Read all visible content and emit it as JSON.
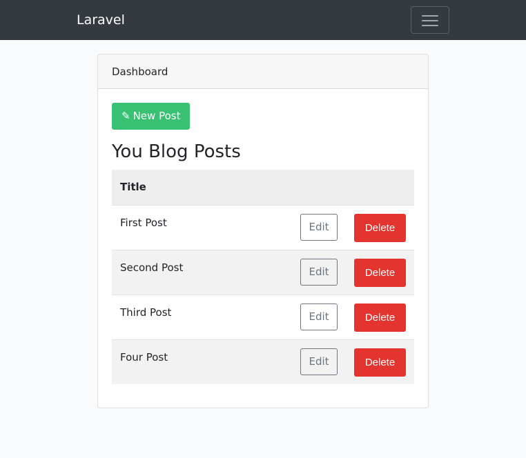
{
  "navbar": {
    "brand": "Laravel",
    "toggler_icon": "hamburger-menu-icon"
  },
  "card": {
    "header": "Dashboard"
  },
  "new_post": {
    "label": "New Post",
    "icon": "pencil-icon"
  },
  "heading": "You Blog Posts",
  "table": {
    "columns": [
      "Title"
    ],
    "rows": [
      {
        "title": "First Post",
        "edit": "Edit",
        "delete": "Delete"
      },
      {
        "title": "Second Post",
        "edit": "Edit",
        "delete": "Delete"
      },
      {
        "title": "Third Post",
        "edit": "Edit",
        "delete": "Delete"
      },
      {
        "title": "Four Post",
        "edit": "Edit",
        "delete": "Delete"
      }
    ]
  },
  "colors": {
    "navbar": "#343a40",
    "success": "#38c172",
    "danger": "#e3342f",
    "secondary": "#6c757d",
    "background": "#f8fafc"
  }
}
